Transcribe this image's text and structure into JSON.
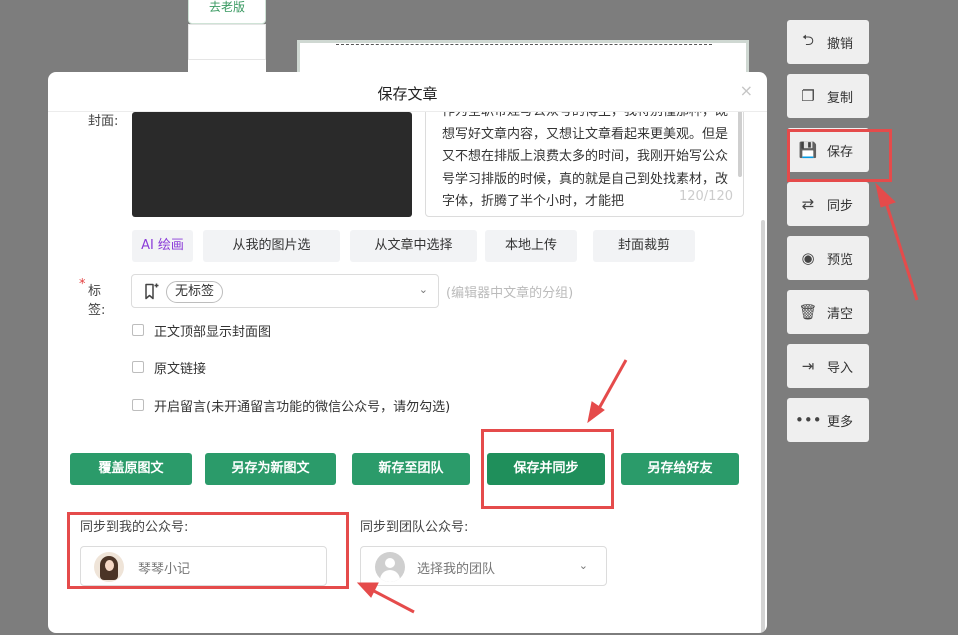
{
  "background": {
    "old_version_button": "去老版"
  },
  "toolbar": {
    "items": [
      {
        "icon": "undo-icon",
        "glyph": "⮌",
        "label": "撤销"
      },
      {
        "icon": "copy-icon",
        "glyph": "❐",
        "label": "复制"
      },
      {
        "icon": "save-icon",
        "glyph": "💾",
        "label": "保存"
      },
      {
        "icon": "sync-icon",
        "glyph": "⇄",
        "label": "同步"
      },
      {
        "icon": "eye-icon",
        "glyph": "◉",
        "label": "预览"
      },
      {
        "icon": "trash-icon",
        "glyph": "🗑",
        "label": "清空"
      },
      {
        "icon": "import-icon",
        "glyph": "⇥",
        "label": "导入"
      },
      {
        "icon": "more-icon",
        "glyph": "•••",
        "label": "更多"
      }
    ]
  },
  "modal": {
    "title": "保存文章",
    "close_glyph": "×",
    "cover_label": "封面:",
    "summary_text": "作为全职带娃写公众号的博主，我特别懂那种，既想写好文章内容，又想让文章看起来更美观。但是又不想在排版上浪费太多的时间，我刚开始写公众号学习排版的时候，真的就是自己到处找素材，改字体，折腾了半个小时，才能把",
    "summary_count": "120/120",
    "cover_actions": [
      "AI 绘画",
      "从我的图片选",
      "从文章中选择",
      "本地上传",
      "封面裁剪"
    ],
    "tag": {
      "required_mark": "*",
      "label": "标签:",
      "chip": "无标签",
      "chevron": "⌄",
      "hint": "(编辑器中文章的分组)"
    },
    "checkboxes": [
      "正文顶部显示封面图",
      "原文链接",
      "开启留言(未开通留言功能的微信公众号，请勿勾选)"
    ],
    "save_actions": [
      "覆盖原图文",
      "另存为新图文",
      "新存至团队",
      "保存并同步",
      "另存给好友"
    ],
    "sync_my": {
      "label": "同步到我的公众号:",
      "account": "琴琴小记"
    },
    "sync_team": {
      "label": "同步到团队公众号:",
      "placeholder": "选择我的团队",
      "chevron": "⌄"
    }
  },
  "colors": {
    "accent_green": "#2b9b6a",
    "annotation_red": "#e54b4b",
    "ai_purple": "#8a3bd8"
  }
}
